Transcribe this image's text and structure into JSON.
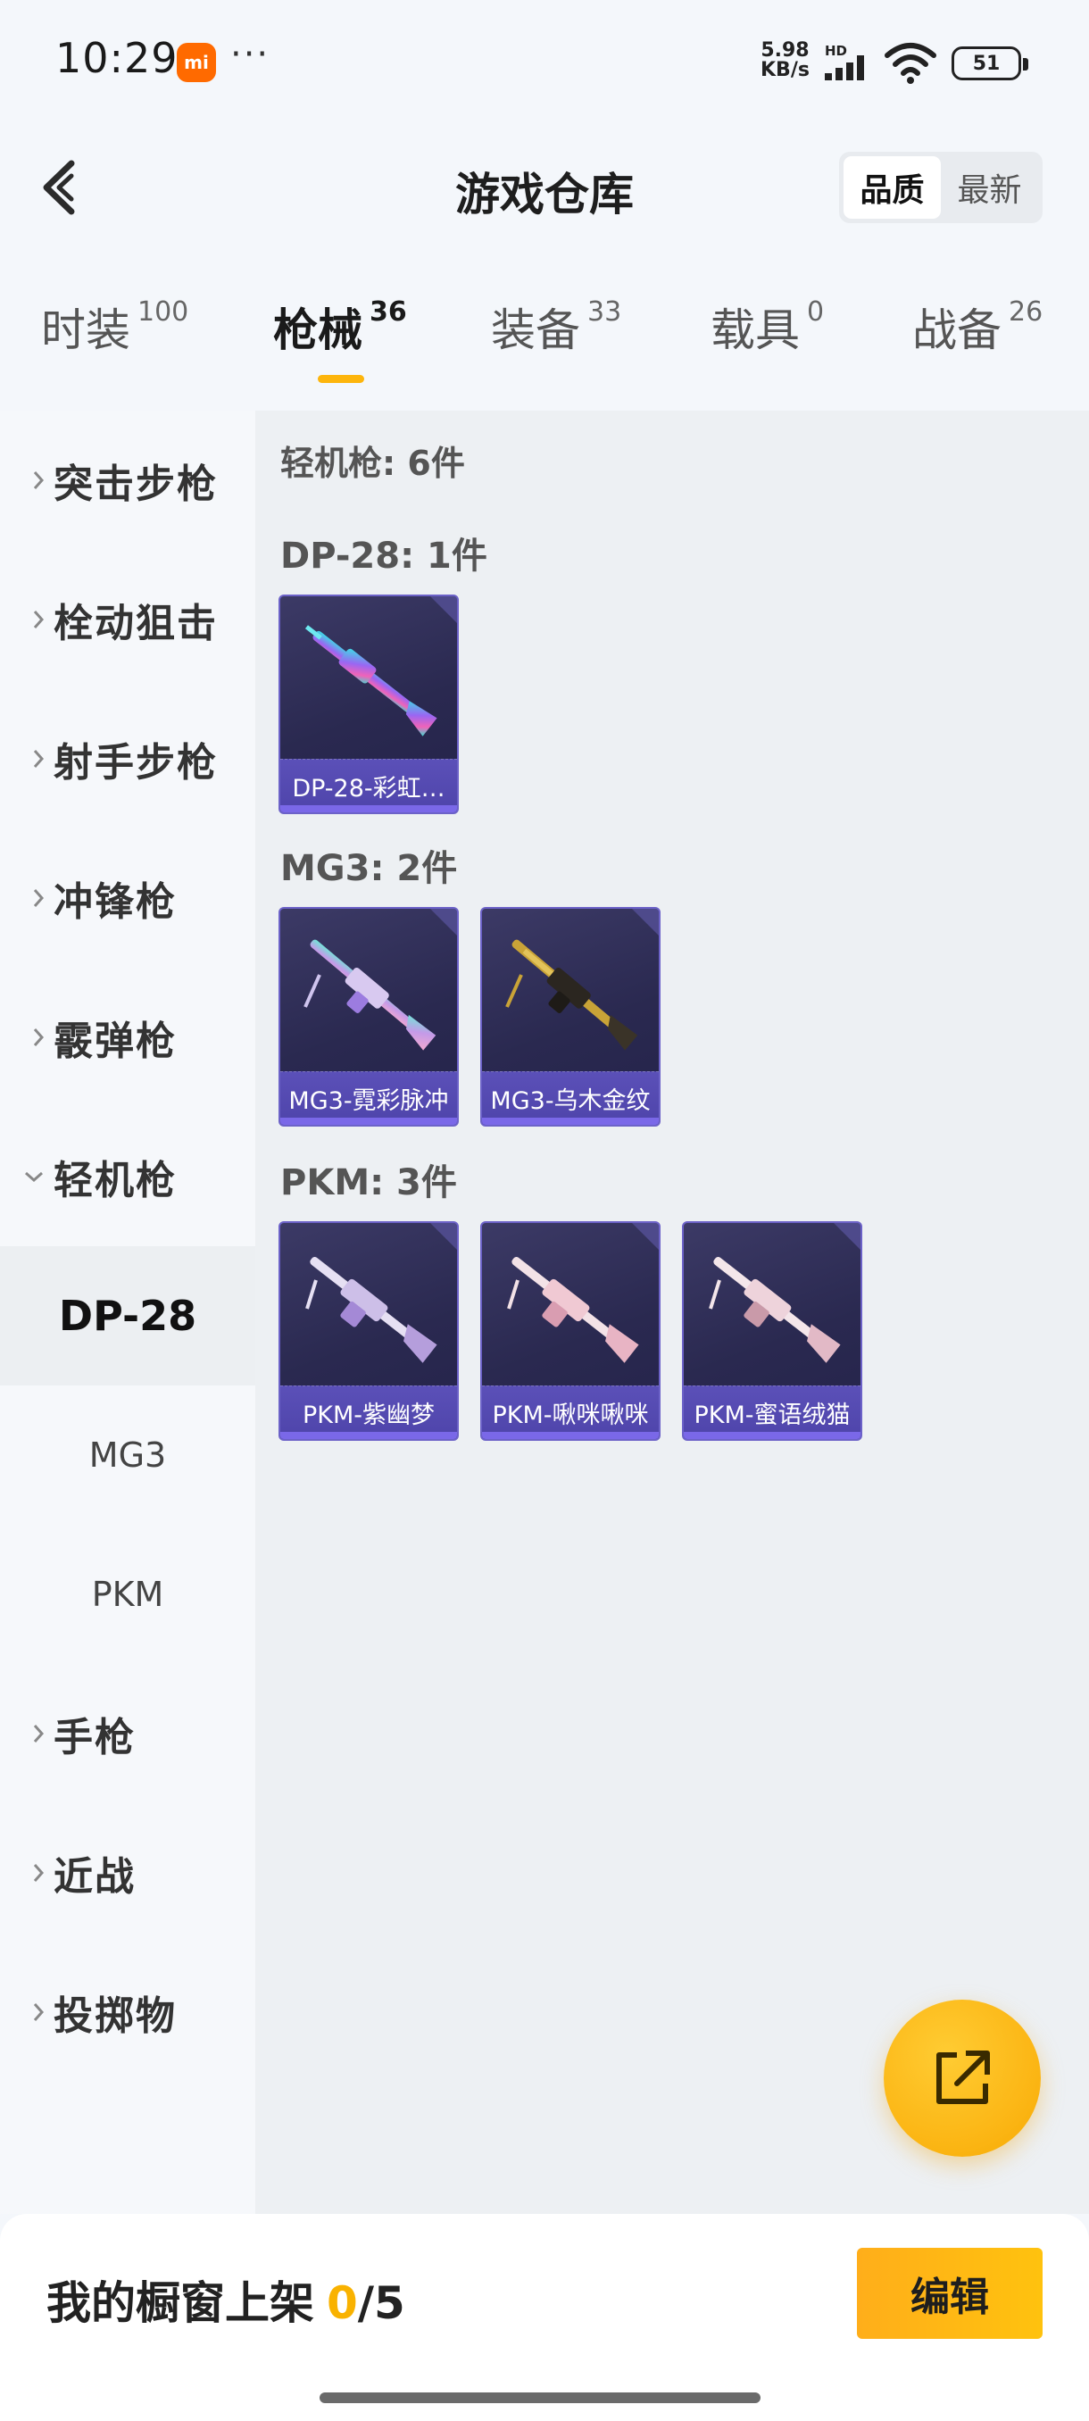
{
  "status_bar": {
    "time": "10:29",
    "mi_label": "mi",
    "dots": "···",
    "speed_value": "5.98",
    "speed_unit": "KB/s",
    "hd_label": "HD",
    "battery": "51"
  },
  "header": {
    "title": "游戏仓库",
    "sort_options": [
      "品质",
      "最新"
    ],
    "sort_selected": "品质"
  },
  "tabs": [
    {
      "label": "时装",
      "count": "100"
    },
    {
      "label": "枪械",
      "count": "36"
    },
    {
      "label": "装备",
      "count": "33"
    },
    {
      "label": "载具",
      "count": "0"
    },
    {
      "label": "战备",
      "count": "26"
    }
  ],
  "active_tab": "枪械",
  "sidebar": {
    "categories": [
      "突击步枪",
      "栓动狙击",
      "射手步枪",
      "冲锋枪",
      "霰弹枪",
      "轻机枪",
      "手枪",
      "近战",
      "投掷物"
    ],
    "expanded": "轻机枪",
    "subitems": [
      "DP-28",
      "MG3",
      "PKM"
    ],
    "selected_sub": "DP-28"
  },
  "content": {
    "total_label": "轻机枪: 6件",
    "groups": [
      {
        "label": "DP-28: 1件",
        "items": [
          "DP-28-彩虹…"
        ]
      },
      {
        "label": "MG3: 2件",
        "items": [
          "MG3-霓彩脉冲",
          "MG3-乌木金纹"
        ]
      },
      {
        "label": "PKM: 3件",
        "items": [
          "PKM-紫幽梦",
          "PKM-啾咪啾咪",
          "PKM-蜜语绒猫"
        ]
      }
    ]
  },
  "bottom": {
    "shelf_label": "我的橱窗上架",
    "shelf_count": "0",
    "shelf_total": "/5",
    "edit_label": "编辑"
  },
  "colors": {
    "accent": "#fdb50c",
    "card_bg": "#2a2950",
    "card_label_bg": "#5b50b8"
  }
}
